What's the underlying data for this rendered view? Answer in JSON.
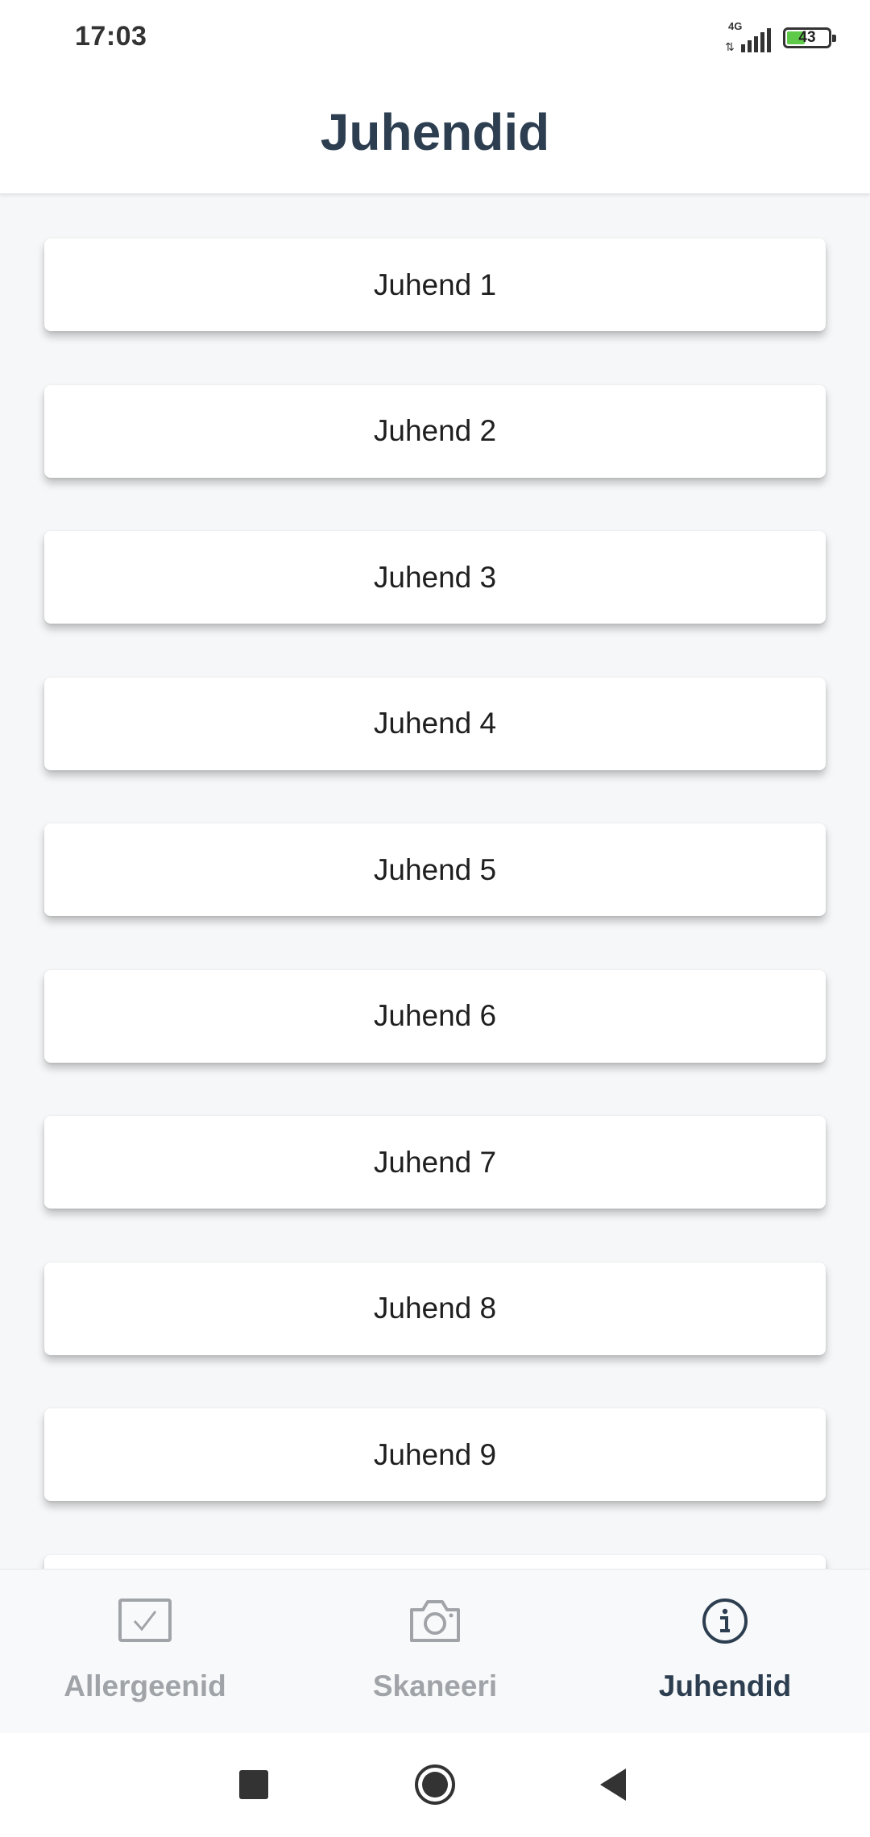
{
  "status_bar": {
    "time": "17:03",
    "network": "4G",
    "battery_level": "43",
    "battery_fraction": 0.43
  },
  "header": {
    "title": "Juhendid"
  },
  "guides": [
    {
      "label": "Juhend 1"
    },
    {
      "label": "Juhend 2"
    },
    {
      "label": "Juhend 3"
    },
    {
      "label": "Juhend 4"
    },
    {
      "label": "Juhend 5"
    },
    {
      "label": "Juhend 6"
    },
    {
      "label": "Juhend 7"
    },
    {
      "label": "Juhend 8"
    },
    {
      "label": "Juhend 9"
    },
    {
      "label": ""
    }
  ],
  "bottom_nav": {
    "items": [
      {
        "label": "Allergeenid",
        "icon": "checkbox-icon",
        "active": false
      },
      {
        "label": "Skaneeri",
        "icon": "camera-icon",
        "active": false
      },
      {
        "label": "Juhendid",
        "icon": "info-icon",
        "active": true
      }
    ]
  },
  "system_nav": {
    "buttons": [
      "recent-apps-icon",
      "home-icon",
      "back-icon"
    ]
  },
  "colors": {
    "accent": "#2c3e50",
    "inactive": "#a0a4a8",
    "background": "#f6f7f8",
    "battery": "#5fc94a"
  }
}
